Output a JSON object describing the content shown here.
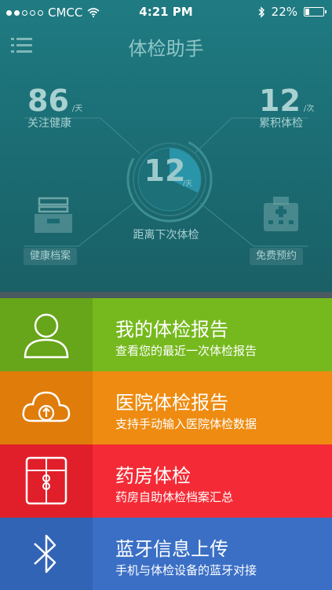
{
  "status": {
    "carrier": "CMCC",
    "time": "4:21 PM",
    "battery": "22%"
  },
  "header": {
    "title": "体检助手"
  },
  "stats": {
    "left": {
      "value": "86",
      "unit": "/天",
      "label": "关注健康"
    },
    "right": {
      "value": "12",
      "unit": "/次",
      "label": "累积体检"
    },
    "center": {
      "value": "12",
      "unit": "/天",
      "label": "距离下次体检"
    }
  },
  "shortcuts": {
    "left": "健康档案",
    "right": "免费预约"
  },
  "menu": [
    {
      "title": "我的体检报告",
      "subtitle": "查看您的最近一次体检报告",
      "color": "#76b91e",
      "dark": "#67a51a",
      "icon": "user-icon"
    },
    {
      "title": "医院体检报告",
      "subtitle": "支持手动输入医院体检数据",
      "color": "#ee8b10",
      "dark": "#e07c0a",
      "icon": "cloud-upload-icon"
    },
    {
      "title": "药房体检",
      "subtitle": "药房自助体检档案汇总",
      "color": "#f42b36",
      "dark": "#e01f2a",
      "icon": "folder-icon"
    },
    {
      "title": "蓝牙信息上传",
      "subtitle": "手机与体检设备的蓝牙对接",
      "color": "#3a6fc5",
      "dark": "#3264b5",
      "icon": "bluetooth-icon"
    }
  ]
}
